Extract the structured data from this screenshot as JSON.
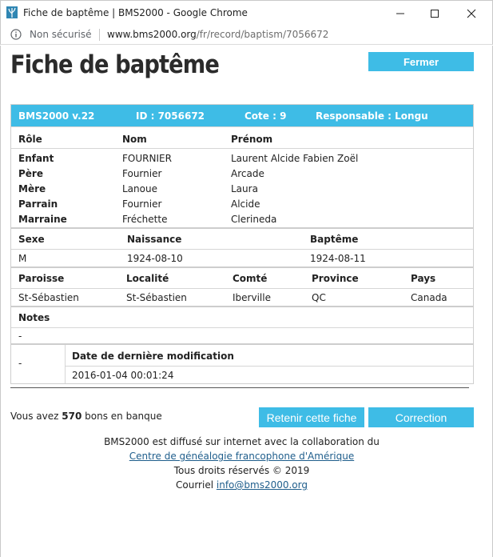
{
  "window": {
    "title": "Fiche de baptême | BMS2000 - Google Chrome",
    "controls": [
      "minimize-icon",
      "maximize-icon",
      "close-icon"
    ]
  },
  "address": {
    "security_label": "Non sécurisé",
    "url_host": "www.bms2000.org",
    "url_path": "/fr/record/baptism/7056672"
  },
  "page": {
    "title": "Fiche de baptême",
    "close_label": "Fermer"
  },
  "record": {
    "header": {
      "version": "BMS2000 v.22",
      "id": "ID : 7056672",
      "cote": "Cote : 9",
      "responsable": "Responsable : Longu"
    },
    "persons_headers": [
      "Rôle",
      "Nom",
      "Prénom"
    ],
    "persons": [
      {
        "role": "Enfant",
        "nom": "FOURNIER",
        "prenom": "Laurent Alcide Fabien Zoël"
      },
      {
        "role": "Père",
        "nom": "Fournier",
        "prenom": "Arcade"
      },
      {
        "role": "Mère",
        "nom": "Lanoue",
        "prenom": "Laura"
      },
      {
        "role": "Parrain",
        "nom": "Fournier",
        "prenom": "Alcide"
      },
      {
        "role": "Marraine",
        "nom": "Fréchette",
        "prenom": "Clerineda"
      }
    ],
    "birth_headers": [
      "Sexe",
      "Naissance",
      "Baptême"
    ],
    "birth": {
      "sexe": "M",
      "naissance": "1924-08-10",
      "bapteme": "1924-08-11"
    },
    "place_headers": [
      "Paroisse",
      "Localité",
      "Comté",
      "Province",
      "Pays"
    ],
    "place": {
      "paroisse": "St-Sébastien",
      "localite": "St-Sébastien",
      "comte": "Iberville",
      "province": "QC",
      "pays": "Canada"
    },
    "notes_label": "Notes",
    "notes_value": "-",
    "mod_left": "-",
    "mod_label": "Date de dernière modification",
    "mod_value": "2016-01-04 00:01:24"
  },
  "actions": {
    "bank_prefix": "Vous avez",
    "bank_count": "570",
    "bank_suffix": "bons en banque",
    "keep_label": "Retenir cette fiche",
    "fix_label": "Correction"
  },
  "footer": {
    "line1": "BMS2000 est diffusé sur internet avec la collaboration du",
    "link_text": "Centre de généalogie francophone d'Amérique",
    "rights": "Tous droits réservés © 2019",
    "email_prefix": "Courriel",
    "email": "info@bms2000.org"
  },
  "colors": {
    "accent": "#3ebce6",
    "link": "#1f5e8c"
  }
}
